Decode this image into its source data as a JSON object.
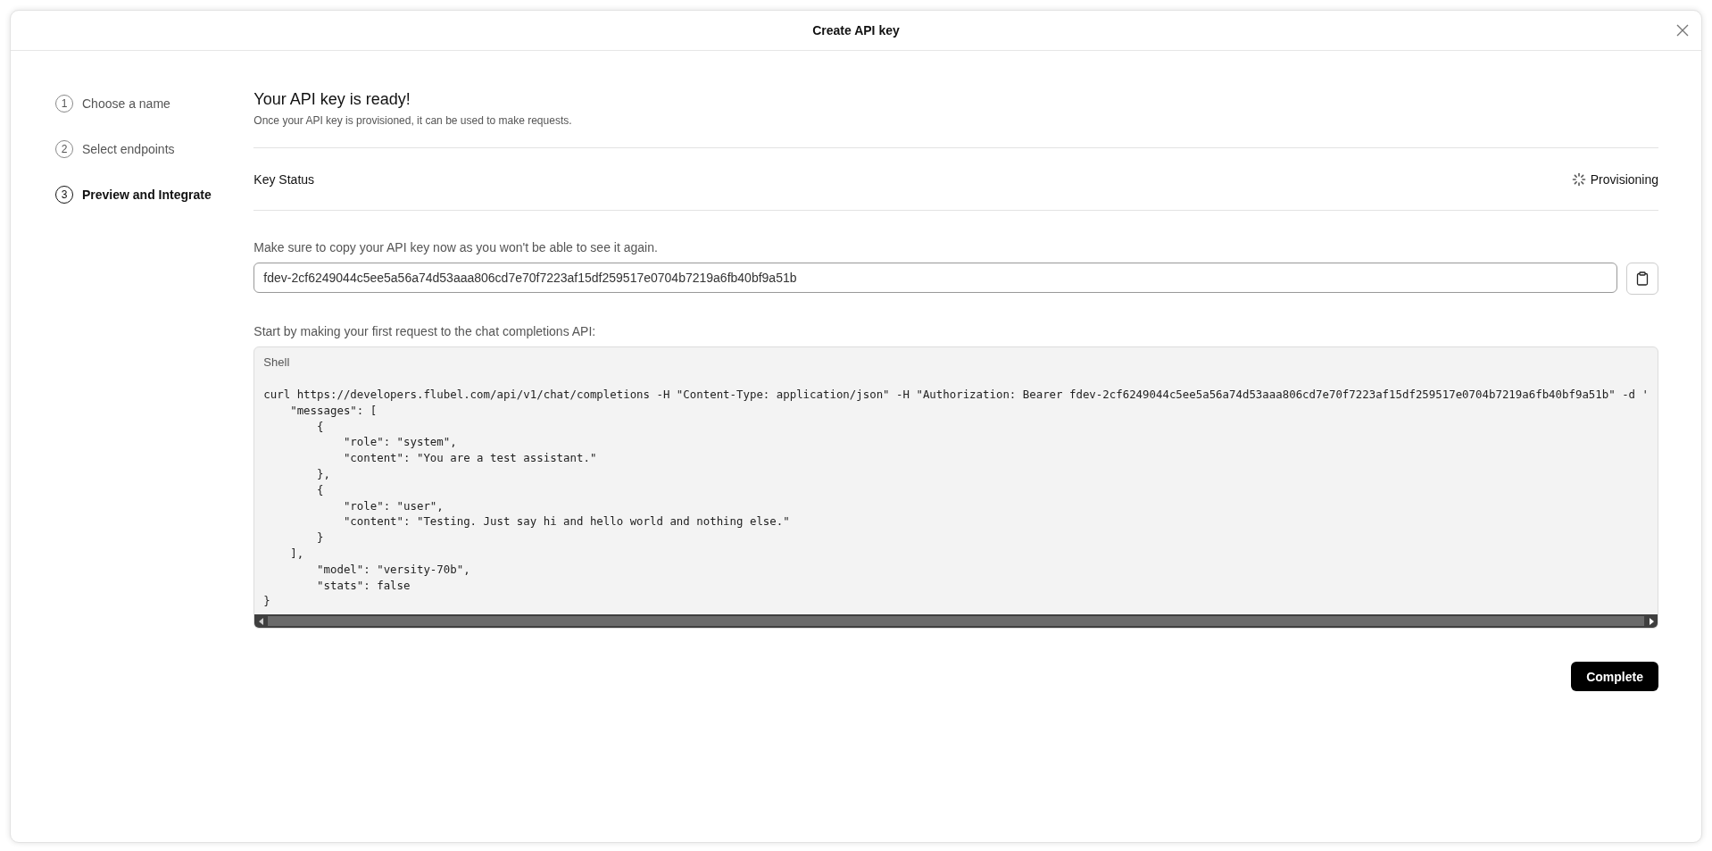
{
  "dialog": {
    "title": "Create API key"
  },
  "steps": [
    {
      "number": "1",
      "label": "Choose a name",
      "selected": false
    },
    {
      "number": "2",
      "label": "Select endpoints",
      "selected": false
    },
    {
      "number": "3",
      "label": "Preview and Integrate",
      "selected": true
    }
  ],
  "heading": "Your API key is ready!",
  "subheading": "Once your API key is provisioned, it can be used to make requests.",
  "key_status": {
    "label": "Key Status",
    "value": "Provisioning"
  },
  "key_field": {
    "label": "Make sure to copy your API key now as you won't be able to see it again.",
    "value": "fdev-2cf6249044c5ee5a56a74d53aaa806cd7e70f7223af15df259517e0704b7219a6fb40bf9a51b"
  },
  "code_section": {
    "label": "Start by making your first request to the chat completions API:",
    "language": "Shell",
    "lines": [
      "curl https://developers.flubel.com/api/v1/chat/completions -H \"Content-Type: application/json\" -H \"Authorization: Bearer fdev-2cf6249044c5ee5a56a74d53aaa806cd7e70f7223af15df259517e0704b7219a6fb40bf9a51b\" -d '",
      "    \"messages\": [",
      "        {",
      "            \"role\": \"system\",",
      "            \"content\": \"You are a test assistant.\"",
      "        },",
      "        {",
      "            \"role\": \"user\",",
      "            \"content\": \"Testing. Just say hi and hello world and nothing else.\"",
      "        }",
      "    ],",
      "        \"model\": \"versity-70b\",",
      "        \"stats\": false",
      "}"
    ]
  },
  "buttons": [
    "Complete"
  ]
}
